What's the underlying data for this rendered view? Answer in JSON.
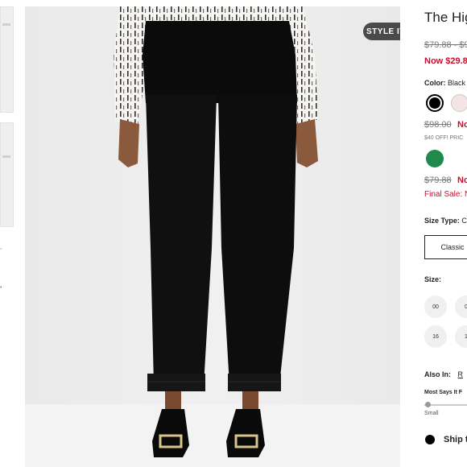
{
  "gallery": {
    "style_it_label": "STYLE IT",
    "main_image_alt": "Model wearing black cuffed ankle pants with beige striped blouse and black buckle heels"
  },
  "product": {
    "title": "The Hig",
    "price_original": "$79.88 - $9",
    "price_now": "Now $29.8",
    "color_label": "Color:",
    "color_value": "Black",
    "alt_price_original": "$98.00",
    "alt_price_sale": "No",
    "promo_text": "$40 OFF! PRIC",
    "alt2_price_original": "$79.88",
    "alt2_price_sale": "No",
    "final_sale": "Final Sale: N",
    "size_type_label": "Size Type:",
    "size_type_value": "C",
    "size_type_button": "Classic",
    "size_label": "Size:",
    "sizes": [
      "00",
      "0",
      "16",
      "1"
    ],
    "also_in_label": "Also In:",
    "also_in_link": "R",
    "fit_label": "Most Says It F",
    "fit_min_label": "Small",
    "ship_label": "Ship t"
  },
  "colors": {
    "black": "#000000",
    "pink": "#f4e4e6",
    "green": "#1f8a4c",
    "sale_red": "#c8102e"
  }
}
